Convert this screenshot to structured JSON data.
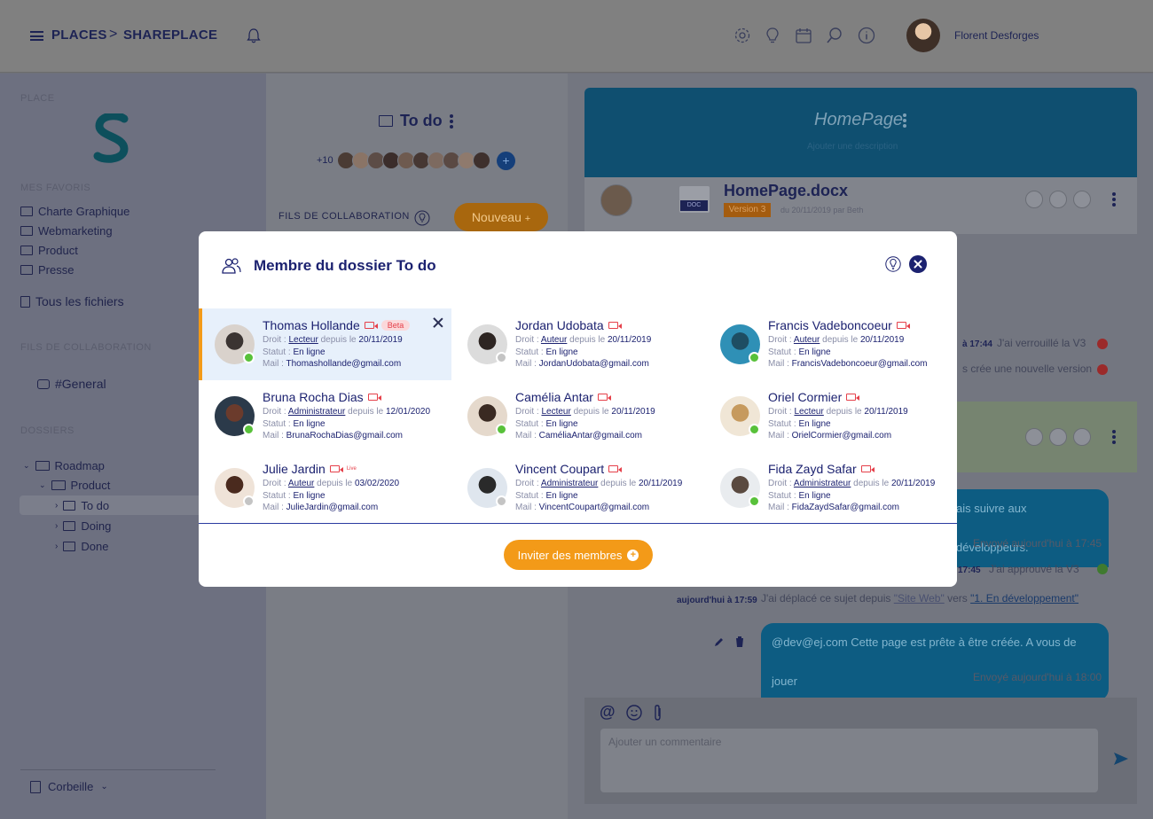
{
  "topbar": {
    "breadcrumb": [
      "PLACES",
      "SHAREPLACE"
    ],
    "separator": ">",
    "user_name": "Florent Desforges"
  },
  "sidebar": {
    "place_label": "PLACE",
    "favorites_label": "MES FAVORIS",
    "favorites": [
      "Charte Graphique",
      "Webmarketing",
      "Product",
      "Presse"
    ],
    "all_files": "Tous les fichiers",
    "collab_label": "FILS DE COLLABORATION",
    "channel": "#General",
    "folders_label": "DOSSIERS",
    "tree": [
      "Roadmap",
      "Product",
      "To do",
      "Doing",
      "Done"
    ],
    "trash": "Corbeille"
  },
  "middle": {
    "folder_title": "To do",
    "extra_members": "+10",
    "collab_label": "FILS DE COLLABORATION",
    "new_button": "Nouveau"
  },
  "right": {
    "page_title": "HomePage",
    "page_subtitle": "Ajouter une description",
    "doc_title": "HomePage.docx",
    "doc_badge": "DOC",
    "version": "Version 3",
    "version_date": "du 20/11/2019 par Beth",
    "messages": {
      "m1_time": "à 17:44",
      "m1_text": "J'ai verrouillé la V3",
      "m2_text": "s crée une nouvelle version",
      "bubble1": "ais suivre aux développeurs.",
      "sent1": "Envoyé aujourd'hui à 17:45",
      "m3_time": "17:45",
      "m3_text": "J'ai approuvé la V3",
      "m4_time": "aujourd'hui à 17:59",
      "m4_text": "J'ai déplacé ce sujet depuis",
      "m4_from": "\"Site Web\"",
      "m4_to_word": "vers",
      "m4_to": "\"1. En développement\"",
      "bubble2": "@dev@ej.com Cette page est prête à être créée. A vous de jouer",
      "sent2": "Envoyé aujourd'hui à 18:00"
    },
    "comment_placeholder": "Ajouter un commentaire"
  },
  "modal": {
    "title": "Membre du dossier To do",
    "invite_label": "Inviter des membres",
    "labels": {
      "droit": "Droit : ",
      "depuis": " depuis le ",
      "statut": "Statut : ",
      "mail": "Mail : "
    },
    "members": [
      {
        "name": "Thomas Hollande",
        "role": "Lecteur",
        "since": "20/11/2019",
        "status": "En ligne",
        "mail": "Thomashollande@gmail.com",
        "badge": "Beta",
        "online": true
      },
      {
        "name": "Jordan Udobata",
        "role": "Auteur",
        "since": "20/11/2019",
        "status": "En ligne",
        "mail": "JordanUdobata@gmail.com",
        "online": false
      },
      {
        "name": "Francis Vadeboncoeur",
        "role": "Auteur",
        "since": "20/11/2019",
        "status": "En ligne",
        "mail": "FrancisVadeboncoeur@gmail.com",
        "online": true
      },
      {
        "name": "Bruna Rocha Dias",
        "role": "Administrateur",
        "since": "12/01/2020",
        "status": "En ligne",
        "mail": "BrunaRochaDias@gmail.com",
        "online": true
      },
      {
        "name": "Camélia Antar",
        "role": "Lecteur",
        "since": "20/11/2019",
        "status": "En ligne",
        "mail": "CaméliaAntar@gmail.com",
        "online": true
      },
      {
        "name": "Oriel Cormier",
        "role": "Lecteur",
        "since": "20/11/2019",
        "status": "En ligne",
        "mail": "OrielCormier@gmail.com",
        "online": true
      },
      {
        "name": "Julie Jardin",
        "role": "Auteur",
        "since": "03/02/2020",
        "status": "En ligne",
        "mail": "JulieJardin@gmail.com",
        "badge": "Live",
        "online": false
      },
      {
        "name": "Vincent Coupart",
        "role": "Administrateur",
        "since": "20/11/2019",
        "status": "En ligne",
        "mail": "VincentCoupart@gmail.com",
        "online": false
      },
      {
        "name": "Fida Zayd Safar",
        "role": "Administrateur",
        "since": "20/11/2019",
        "status": "En ligne",
        "mail": "FidaZaydSafar@gmail.com",
        "online": true
      }
    ]
  },
  "colors": {
    "accent": "#f39a18",
    "navy": "#1c2270",
    "online": "#58c13a",
    "offline": "#c4c4c4",
    "live": "#e5404a"
  }
}
